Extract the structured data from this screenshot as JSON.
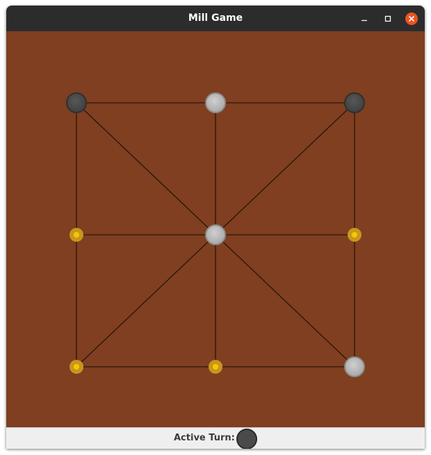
{
  "window": {
    "title": "Mill Game"
  },
  "board": {
    "background": "#7f3f20",
    "line_color": "#1a0d06",
    "points": [
      {
        "id": "top-left",
        "state": "dark"
      },
      {
        "id": "top-center",
        "state": "light"
      },
      {
        "id": "top-right",
        "state": "dark"
      },
      {
        "id": "middle-left",
        "state": "empty"
      },
      {
        "id": "center",
        "state": "light"
      },
      {
        "id": "middle-right",
        "state": "empty"
      },
      {
        "id": "bottom-left",
        "state": "empty"
      },
      {
        "id": "bottom-center",
        "state": "empty"
      },
      {
        "id": "bottom-right",
        "state": "light"
      }
    ],
    "piece_colors": {
      "dark": "#4a4a4a",
      "light": "#b4b4b4",
      "empty_marker": "#c8961e",
      "empty_dot": "#f5c800"
    }
  },
  "status": {
    "label": "Active Turn:",
    "active_piece": "dark"
  }
}
